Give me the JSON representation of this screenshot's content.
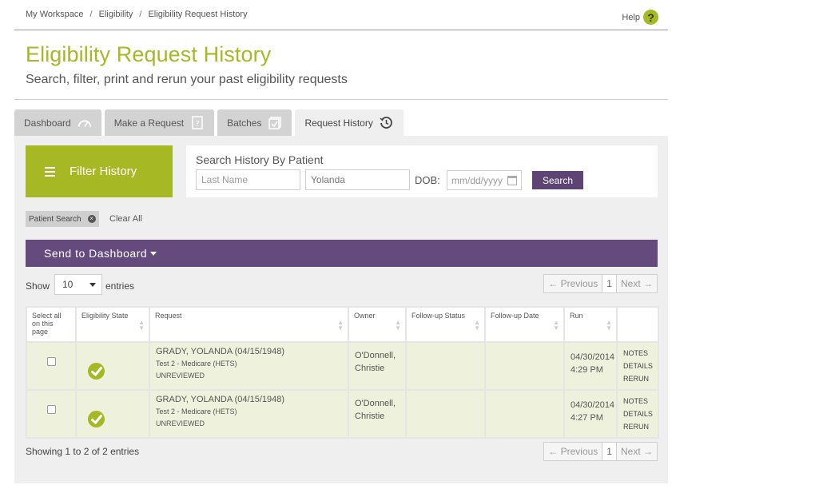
{
  "breadcrumb": [
    "My Workspace",
    "Eligibility",
    "Eligibility Request History"
  ],
  "help_label": "Help",
  "page": {
    "title": "Eligibility Request History",
    "subtitle": "Search, filter, print and rerun your past eligibility requests"
  },
  "tabs": [
    {
      "label": "Dashboard",
      "icon": "gauge-icon"
    },
    {
      "label": "Make a Request",
      "icon": "question-doc-icon"
    },
    {
      "label": "Batches",
      "icon": "batches-icon"
    },
    {
      "label": "Request History",
      "icon": "history-clock-icon",
      "active": true
    }
  ],
  "filter": {
    "button_label": "Filter History",
    "search_title": "Search History By Patient",
    "last_name_placeholder": "Last Name",
    "first_name_value": "Yolanda",
    "dob_label": "DOB:",
    "dob_placeholder": "mm/dd/yyyy",
    "search_button": "Search",
    "active_chip": "Patient Search",
    "clear_all": "Clear All"
  },
  "send_bar_label": "Send to Dashboard",
  "list_controls": {
    "show_label": "Show",
    "entries_value": "10",
    "entries_label": "entries",
    "prev_label": "← Previous",
    "page_number": "1",
    "next_label": "Next →"
  },
  "table": {
    "headers": [
      "Select all on this page",
      "Eligibility State",
      "Request",
      "Owner",
      "Follow-up Status",
      "Follow-up Date",
      "Run",
      ""
    ],
    "rows": [
      {
        "patient": "GRADY, YOLANDA (04/15/1948)",
        "plan": "Test 2 - Medicare (HETS)",
        "review": "UNREVIEWED",
        "owner_last": "O'Donnell,",
        "owner_first": "Christie",
        "followup_status": "",
        "followup_date": "",
        "run_date": "04/30/2014",
        "run_time": "4:29 PM",
        "actions": [
          "NOTES",
          "DETAILS",
          "RERUN"
        ]
      },
      {
        "patient": "GRADY, YOLANDA (04/15/1948)",
        "plan": "Test 2 - Medicare (HETS)",
        "review": "UNREVIEWED",
        "owner_last": "O'Donnell,",
        "owner_first": "Christie",
        "followup_status": "",
        "followup_date": "",
        "run_date": "04/30/2014",
        "run_time": "4:27 PM",
        "actions": [
          "NOTES",
          "DETAILS",
          "RERUN"
        ]
      }
    ]
  },
  "showing_text": "Showing 1 to 2 of 2 entries",
  "colors": {
    "accent_green": "#a6b824",
    "purple": "#654a7e",
    "row_bg": "#eef2dc"
  }
}
